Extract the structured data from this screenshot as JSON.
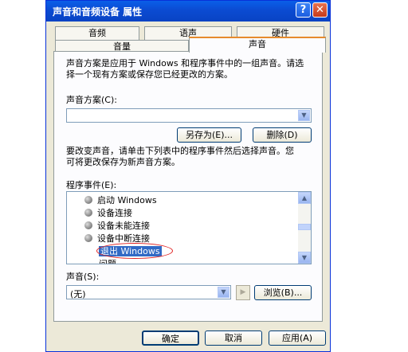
{
  "window": {
    "title": "声音和音频设备 属性",
    "help": "?",
    "close": "✕"
  },
  "tabs": {
    "row1": [
      "音频",
      "语声",
      "硬件"
    ],
    "row2": [
      "音量",
      "声音"
    ],
    "active": "声音"
  },
  "scheme": {
    "description_line1": "声音方案是应用于 Windows 和程序事件中的一组声音。请选",
    "description_line2": "择一个现有方案或保存您已经更改的方案。",
    "label": "声音方案(C):",
    "value": "",
    "save_as_label": "另存为(E)...",
    "delete_label": "删除(D)"
  },
  "events": {
    "description_line1": "要改变声音，请单击下列表中的程序事件然后选择声音。您",
    "description_line2": "可将更改保存为新声音方案。",
    "label": "程序事件(E):",
    "items": [
      "启动 Windows",
      "设备连接",
      "设备未能连接",
      "设备中断连接",
      "退出 Windows",
      "问题"
    ],
    "selected_index": 4
  },
  "sound": {
    "label": "声音(S):",
    "value": "(无)",
    "play_icon": "play-icon",
    "browse_label": "浏览(B)..."
  },
  "footer": {
    "ok": "确定",
    "cancel": "取消",
    "apply": "应用(A)"
  },
  "colors": {
    "titlebar": "#0b4bd2",
    "face": "#ece9d8",
    "selection": "#316ac5",
    "annotation": "#e02020"
  }
}
